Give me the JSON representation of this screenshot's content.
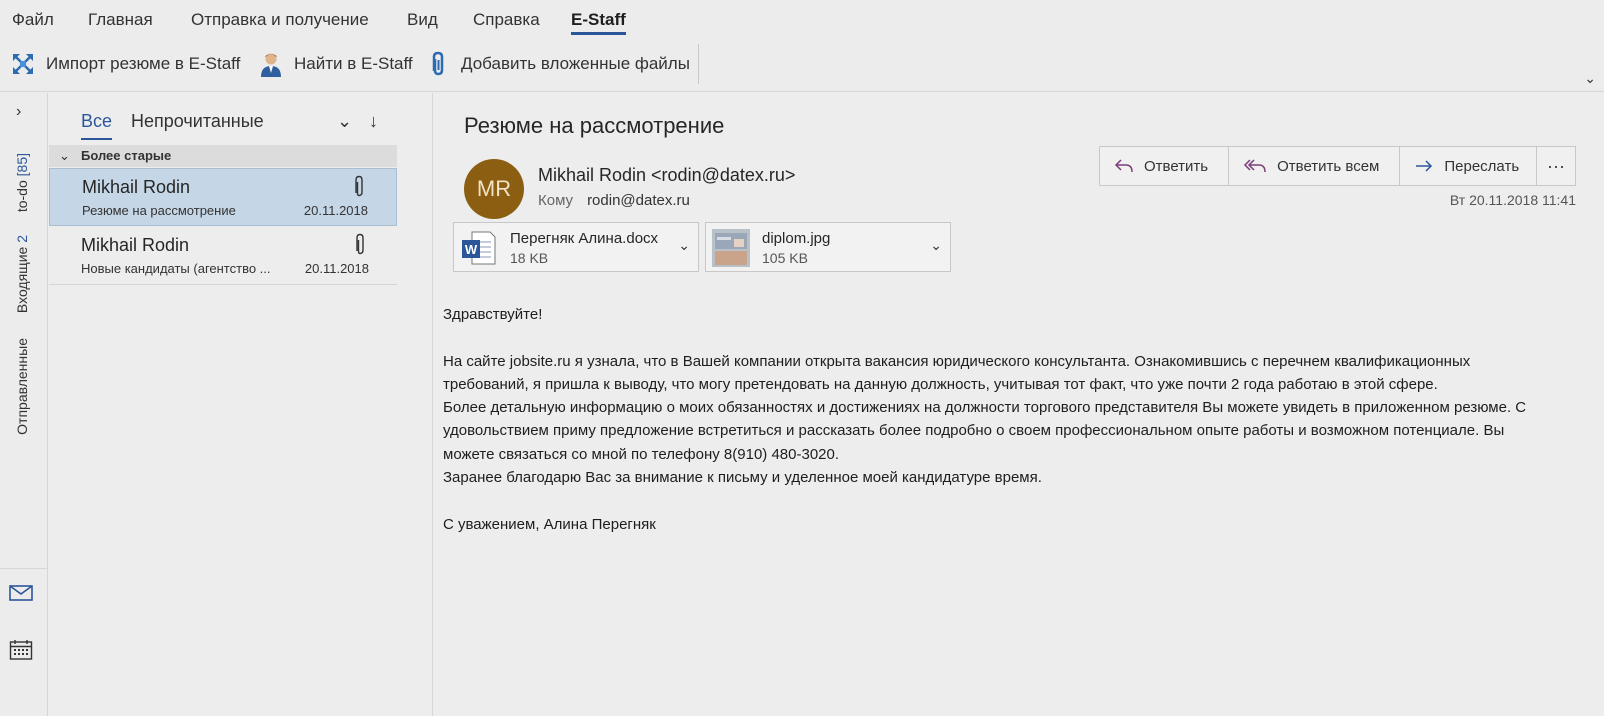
{
  "ribbon": {
    "tabs": [
      "Файл",
      "Главная",
      "Отправка и получение",
      "Вид",
      "Справка",
      "E-Staff"
    ],
    "active_tab": "E-Staff",
    "commands": {
      "import": "Импорт резюме в E-Staff",
      "find": "Найти в E-Staff",
      "attach": "Добавить вложенные файлы"
    }
  },
  "rail": {
    "folders": [
      {
        "label": "to-do",
        "count": "[85]"
      },
      {
        "label": "Входящие",
        "count": "2"
      },
      {
        "label": "Отправленные",
        "count": ""
      }
    ],
    "icons": [
      "mail-icon",
      "calendar-icon"
    ]
  },
  "list": {
    "filter_all": "Все",
    "filter_unread": "Непрочитанные",
    "group_label": "Более старые",
    "items": [
      {
        "from": "Mikhail Rodin",
        "subject": "Резюме на рассмотрение",
        "date": "20.11.2018",
        "selected": true,
        "has_attachment": true
      },
      {
        "from": "Mikhail Rodin",
        "subject": "Новые кандидаты (агентство ...",
        "date": "20.11.2018",
        "selected": false,
        "has_attachment": true
      }
    ]
  },
  "message": {
    "subject": "Резюме на рассмотрение",
    "avatar_initials": "MR",
    "avatar_color": "#8b5e12",
    "sender": "Mikhail Rodin <rodin@datex.ru>",
    "to_label": "Кому",
    "to": "rodin@datex.ru",
    "date": "Вт 20.11.2018 11:41",
    "actions": {
      "reply": "Ответить",
      "reply_all": "Ответить всем",
      "forward": "Переслать",
      "more": "···"
    },
    "attachments": [
      {
        "name": "Перегняк Алина.docx",
        "size": "18 KB",
        "icon": "word-doc-icon"
      },
      {
        "name": "diplom.jpg",
        "size": "105 KB",
        "icon": "image-thumbnail"
      }
    ],
    "body": {
      "greeting": "Здравствуйте!",
      "p1": "На сайте jobsite.ru я узнала, что в Вашей компании открыта вакансия юридического консультанта. Ознакомившись с перечнем квалификационных требований, я пришла к выводу, что могу претендовать на данную должность, учитывая тот факт, что уже почти 2 года работаю в этой сфере.",
      "p2": "Более детальную информацию о моих обязанностях и достижениях на должности торгового представителя Вы можете увидеть в приложенном резюме. С удовольствием приму предложение встретиться и рассказать более подробно о своем профессиональном опыте работы и возможном потенциале. Вы можете связаться со мной по телефону  8(910) 480-3020.",
      "p3": "Заранее благодарю Вас за внимание к письму и уделенное моей кандидатуре время.",
      "signature": "С уважением, Алина Перегняк"
    }
  }
}
